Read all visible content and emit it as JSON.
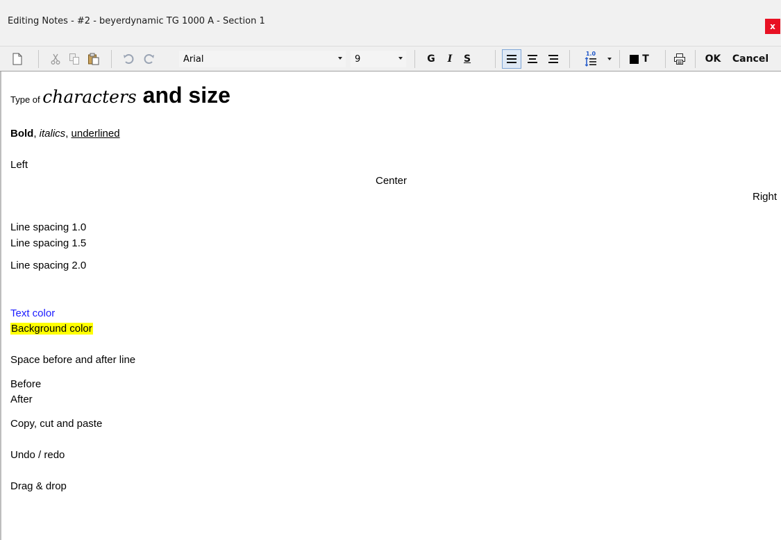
{
  "window": {
    "title": "Editing Notes - #2 - beyerdynamic TG 1000 A  -  Section 1",
    "close_glyph": "x",
    "close_color": "#e81123"
  },
  "toolbar": {
    "font_name": "Arial",
    "font_size": "9",
    "bold_label": "G",
    "italic_label": "I",
    "underline_label": "S",
    "line_spacing_badge": "1.0",
    "color_label": "T",
    "ok_label": "OK",
    "cancel_label": "Cancel",
    "icons": [
      "new-document-icon",
      "cut-icon",
      "copy-icon",
      "paste-icon",
      "undo-icon",
      "redo-icon",
      "align-left-icon",
      "align-center-icon",
      "align-right-icon",
      "line-spacing-icon",
      "text-color-icon",
      "print-icon"
    ]
  },
  "document": {
    "type_of": "Type of ",
    "characters": "characters",
    "and_size": " and size",
    "bold": "Bold",
    "comma1": ", ",
    "italics": "italics",
    "comma2": ", ",
    "underlined": "underlined",
    "left": "Left",
    "center": "Center",
    "right": "Right",
    "spacing_10": "Line spacing 1.0",
    "spacing_15": "Line spacing 1.5",
    "spacing_20": "Line spacing 2.0",
    "text_color": "Text color",
    "text_color_value": "#1a1aff",
    "background_color": "Background color",
    "background_color_value": "#ffff00",
    "space_before_after": "Space before and after line",
    "before": "Before",
    "after": "After",
    "copy_cut_paste": "Copy, cut and paste",
    "undo_redo": "Undo / redo",
    "drag_drop": "Drag & drop"
  }
}
